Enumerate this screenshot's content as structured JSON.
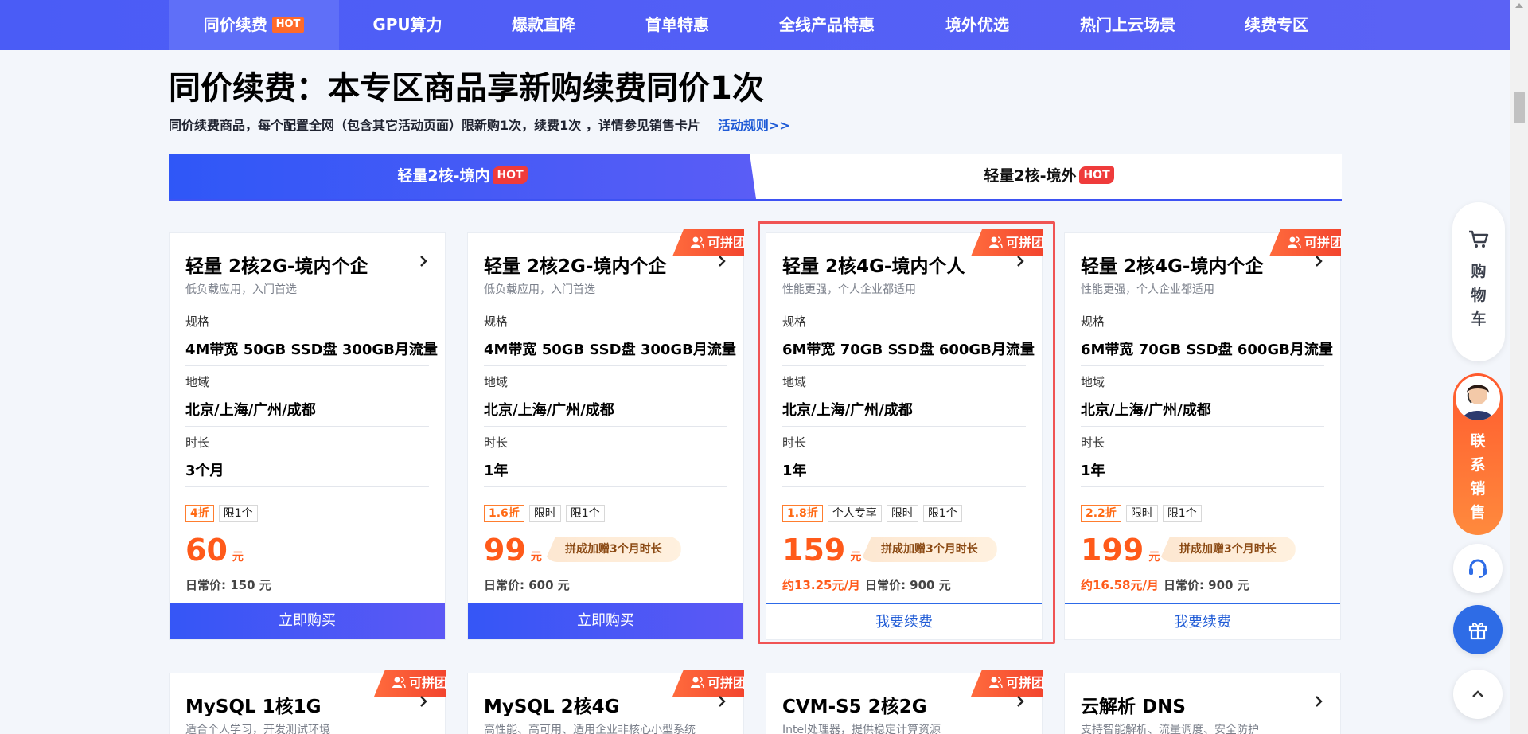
{
  "nav": {
    "items": [
      {
        "label": "同价续费",
        "hot": "HOT"
      },
      {
        "label": "GPU算力"
      },
      {
        "label": "爆款直降"
      },
      {
        "label": "首单特惠"
      },
      {
        "label": "全线产品特惠"
      },
      {
        "label": "境外优选"
      },
      {
        "label": "热门上云场景"
      },
      {
        "label": "续费专区"
      }
    ]
  },
  "header": {
    "title": "同价续费：本专区商品享新购续费同价1次",
    "desc": "同价续费商品，每个配置全网（包含其它活动页面）限新购1次，续费1次 ，详情参见销售卡片",
    "rules_link": "活动规则>>"
  },
  "tabs": [
    {
      "label": "轻量2核-境内",
      "hot": "HOT"
    },
    {
      "label": "轻量2核-境外",
      "hot": "HOT"
    }
  ],
  "labels": {
    "spec": "规格",
    "region": "地域",
    "duration": "时长",
    "group_buy": "可拼团",
    "yuan": "元",
    "daily_prefix": "日常价: ",
    "bonus": "拼成加赠3个月时长"
  },
  "products": [
    {
      "title": "轻量 2核2G-境内个企",
      "subtitle": "低负载应用，入门首选",
      "spec": "4M带宽 50GB SSD盘 300GB月流量",
      "region": "北京/上海/广州/成都",
      "duration": "3个月",
      "tags": [
        "4折",
        "限1个"
      ],
      "price": "60",
      "daily": "150 元",
      "monthly": "",
      "button": "立即购买"
    },
    {
      "title": "轻量 2核2G-境内个企",
      "subtitle": "低负载应用，入门首选",
      "spec": "4M带宽 50GB SSD盘 300GB月流量",
      "region": "北京/上海/广州/成都",
      "duration": "1年",
      "tags": [
        "1.6折",
        "限时",
        "限1个"
      ],
      "price": "99",
      "daily": "600 元",
      "monthly": "",
      "button": "立即购买"
    },
    {
      "title": "轻量 2核4G-境内个人",
      "subtitle": "性能更强，个人企业都适用",
      "spec": "6M带宽 70GB SSD盘 600GB月流量",
      "region": "北京/上海/广州/成都",
      "duration": "1年",
      "tags": [
        "1.8折",
        "个人专享",
        "限时",
        "限1个"
      ],
      "price": "159",
      "daily": "900 元",
      "monthly": "约13.25元/月",
      "button": "我要续费"
    },
    {
      "title": "轻量 2核4G-境内个企",
      "subtitle": "性能更强，个人企业都适用",
      "spec": "6M带宽 70GB SSD盘 600GB月流量",
      "region": "北京/上海/广州/成都",
      "duration": "1年",
      "tags": [
        "2.2折",
        "限时",
        "限1个"
      ],
      "price": "199",
      "daily": "900 元",
      "monthly": "约16.58元/月",
      "button": "我要续费"
    }
  ],
  "products_row2": [
    {
      "title": "MySQL 1核1G",
      "subtitle": "适合个人学习，开发测试环境"
    },
    {
      "title": "MySQL 2核4G",
      "subtitle": "高性能、高可用、适用企业非核心小型系统"
    },
    {
      "title": "CVM-S5 2核2G",
      "subtitle": "Intel处理器，提供稳定计算资源"
    },
    {
      "title": "云解析 DNS",
      "subtitle": "支持智能解析、流量调度、安全防护"
    }
  ],
  "side": {
    "cart": "购物车",
    "sales": "联系销售"
  },
  "colors": {
    "nav_bg": "#4a5cf6",
    "accent_orange": "#ff5a1a",
    "link_blue": "#1f5bd6",
    "highlight_red": "#f05454"
  }
}
